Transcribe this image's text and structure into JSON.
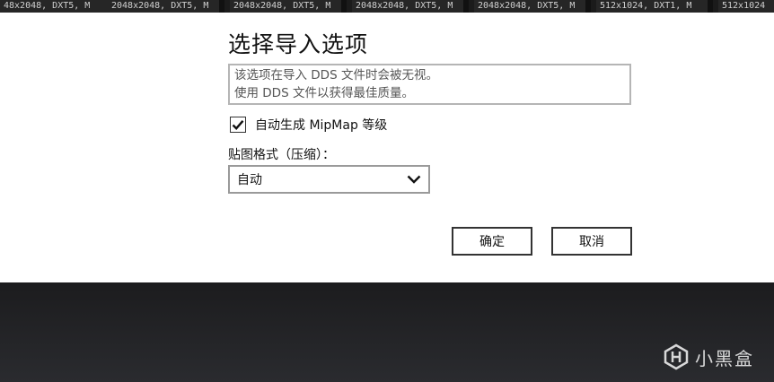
{
  "thumbnail_strip": {
    "items": [
      "48x2048, DXT5, M",
      "2048x2048, DXT5, M",
      "2048x2048, DXT5, M",
      "2048x2048, DXT5, M",
      "2048x2048, DXT5, M",
      "512x1024, DXT1, M",
      "512x1024"
    ]
  },
  "dialog": {
    "title": "选择导入选项",
    "notice_lines": [
      "该选项在导入 DDS 文件时会被无视。",
      "使用 DDS 文件以获得最佳质量。"
    ],
    "mipmap_checkbox": {
      "label": "自动生成 MipMap 等级",
      "checked": true
    },
    "format_label": "贴图格式（压缩）：",
    "format_select": {
      "value": "自动",
      "icon": "chevron-down-icon"
    },
    "ok_button": "确定",
    "cancel_button": "取消"
  },
  "watermark": {
    "text": "小黑盒",
    "icon": "heybox-logo"
  }
}
